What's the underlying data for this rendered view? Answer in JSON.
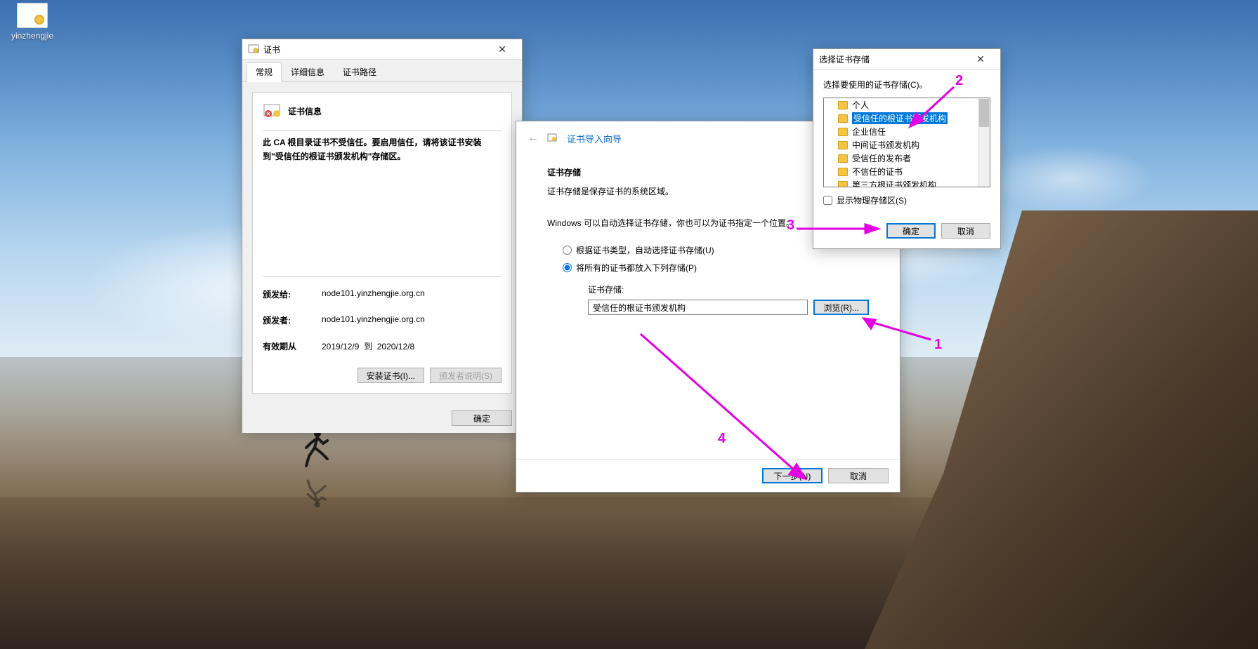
{
  "desktop": {
    "icon_label": "yinzhengjie"
  },
  "cert": {
    "title": "证书",
    "tabs": {
      "general": "常规",
      "details": "详细信息",
      "path": "证书路径"
    },
    "info_header": "证书信息",
    "warn_text": "此 CA 根目录证书不受信任。要启用信任，请将该证书安装到\"受信任的根证书颁发机构\"存储区。",
    "issued_to_label": "颁发给:",
    "issued_to_value": "node101.yinzhengjie.org.cn",
    "issued_by_label": "颁发者:",
    "issued_by_value": "node101.yinzhengjie.org.cn",
    "valid_label": "有效期从",
    "valid_from": "2019/12/9",
    "valid_to_label": "到",
    "valid_to": "2020/12/8",
    "install_button": "安装证书(I)...",
    "issuer_statement_button": "颁发者说明(S)",
    "ok_button": "确定"
  },
  "wizard": {
    "title": "证书导入向导",
    "section_title": "证书存储",
    "section_desc": "证书存储是保存证书的系统区域。",
    "hint": "Windows 可以自动选择证书存储，你也可以为证书指定一个位置。",
    "radio_auto": "根据证书类型，自动选择证书存储(U)",
    "radio_manual": "将所有的证书都放入下列存储(P)",
    "store_label": "证书存储:",
    "store_value": "受信任的根证书颁发机构",
    "browse_button": "浏览(R)...",
    "next_button": "下一步(N)",
    "cancel_button": "取消"
  },
  "picker": {
    "title": "选择证书存储",
    "instruction": "选择要使用的证书存储(C)。",
    "items": {
      "personal": "个人",
      "trusted_root": "受信任的根证书颁发机构",
      "enterprise": "企业信任",
      "intermediate": "中间证书颁发机构",
      "trusted_pub": "受信任的发布者",
      "untrusted": "不信任的证书",
      "third_party": "第三方根证书颁发机构"
    },
    "show_physical": "显示物理存储区(S)",
    "ok_button": "确定",
    "cancel_button": "取消"
  },
  "annotations": {
    "n1": "1",
    "n2": "2",
    "n3": "3",
    "n4": "4"
  }
}
